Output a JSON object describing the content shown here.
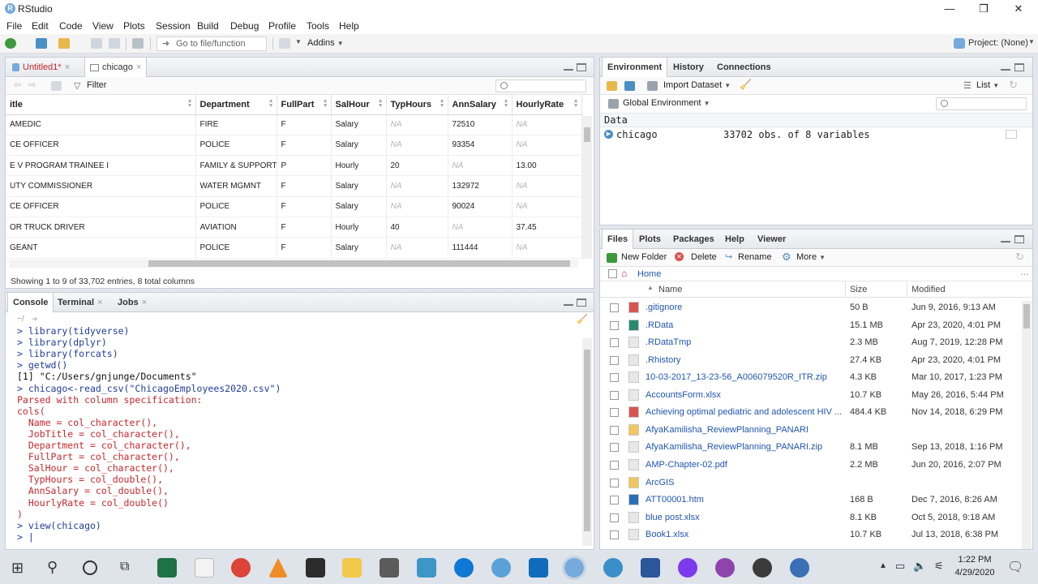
{
  "window": {
    "title": "RStudio",
    "controls": [
      "—",
      "❐",
      "✕"
    ]
  },
  "menu": [
    "File",
    "Edit",
    "Code",
    "View",
    "Plots",
    "Session",
    "Build",
    "Debug",
    "Profile",
    "Tools",
    "Help"
  ],
  "toolbar": {
    "goto_placeholder": "Go to file/function",
    "addins_label": "Addins",
    "project_label": "Project: (None)"
  },
  "source_pane": {
    "tabs": [
      {
        "label": "Untitled1*"
      },
      {
        "label": "chicago"
      }
    ],
    "filter_label": "Filter",
    "columns": [
      "itle",
      "Department",
      "FullPart",
      "SalHour",
      "TypHours",
      "AnnSalary",
      "HourlyRate"
    ],
    "rows": [
      [
        "AMEDIC",
        "FIRE",
        "F",
        "Salary",
        "NA",
        "72510",
        "NA"
      ],
      [
        "CE OFFICER",
        "POLICE",
        "F",
        "Salary",
        "NA",
        "93354",
        "NA"
      ],
      [
        "E V PROGRAM TRAINEE I",
        "FAMILY & SUPPORT",
        "P",
        "Hourly",
        "20",
        "NA",
        "13.00"
      ],
      [
        "UTY COMMISSIONER",
        "WATER MGMNT",
        "F",
        "Salary",
        "NA",
        "132972",
        "NA"
      ],
      [
        "CE OFFICER",
        "POLICE",
        "F",
        "Salary",
        "NA",
        "90024",
        "NA"
      ],
      [
        "OR TRUCK DRIVER",
        "AVIATION",
        "F",
        "Hourly",
        "40",
        "NA",
        "37.45"
      ],
      [
        "GEANT",
        "POLICE",
        "F",
        "Salary",
        "NA",
        "111444",
        "NA"
      ]
    ],
    "footer": "Showing 1 to 9 of 33,702 entries, 8 total columns"
  },
  "console_pane": {
    "tabs": [
      {
        "label": "Console"
      },
      {
        "label": "Terminal"
      },
      {
        "label": "Jobs"
      }
    ],
    "path": "~/",
    "lines": [
      {
        "text": "> library(tidyverse)",
        "style": "blue"
      },
      {
        "text": "> library(dplyr)",
        "style": "blue"
      },
      {
        "text": "> library(forcats)",
        "style": "blue"
      },
      {
        "text": "> getwd()",
        "style": "blue"
      },
      {
        "text": "[1] \"C:/Users/gnjunge/Documents\"",
        "style": "black"
      },
      {
        "text": "> chicago<-read_csv(\"ChicagoEmployees2020.csv\")",
        "style": "blue"
      },
      {
        "text": "Parsed with column specification:",
        "style": "red"
      },
      {
        "text": "cols(",
        "style": "red"
      },
      {
        "text": "  Name = col_character(),",
        "style": "red"
      },
      {
        "text": "  JobTitle = col_character(),",
        "style": "red"
      },
      {
        "text": "  Department = col_character(),",
        "style": "red"
      },
      {
        "text": "  FullPart = col_character(),",
        "style": "red"
      },
      {
        "text": "  SalHour = col_character(),",
        "style": "red"
      },
      {
        "text": "  TypHours = col_double(),",
        "style": "red"
      },
      {
        "text": "  AnnSalary = col_double(),",
        "style": "red"
      },
      {
        "text": "  HourlyRate = col_double()",
        "style": "red"
      },
      {
        "text": ")",
        "style": "red"
      },
      {
        "text": "> view(chicago)",
        "style": "blue"
      },
      {
        "text": "> |",
        "style": "blue"
      }
    ]
  },
  "env_pane": {
    "tabs": [
      {
        "label": "Environment"
      },
      {
        "label": "History"
      },
      {
        "label": "Connections"
      }
    ],
    "import_label": "Import Dataset",
    "list_label": "List",
    "global_env_label": "Global Environment",
    "section_label": "Data",
    "object_name": "chicago",
    "object_desc": "33702 obs. of 8 variables"
  },
  "files_pane": {
    "tabs": [
      {
        "label": "Files"
      },
      {
        "label": "Plots"
      },
      {
        "label": "Packages"
      },
      {
        "label": "Help"
      },
      {
        "label": "Viewer"
      }
    ],
    "new_folder_label": "New Folder",
    "delete_label": "Delete",
    "rename_label": "Rename",
    "more_label": "More",
    "home_label": "Home",
    "col_name": "Name",
    "col_size": "Size",
    "col_modified": "Modified",
    "files": [
      {
        "name": ".gitignore",
        "size": "50 B",
        "modified": "Jun 9, 2016, 9:13 AM",
        "icon_color": "#d9534f"
      },
      {
        "name": ".RData",
        "size": "15.1 MB",
        "modified": "Apr 23, 2020, 4:01 PM",
        "icon_color": "#2b8a6e"
      },
      {
        "name": ".RDataTmp",
        "size": "2.3 MB",
        "modified": "Aug 7, 2019, 12:28 PM",
        "icon_color": "#e8e8e8"
      },
      {
        "name": ".Rhistory",
        "size": "27.4 KB",
        "modified": "Apr 23, 2020, 4:01 PM",
        "icon_color": "#e8e8e8"
      },
      {
        "name": "10-03-2017_13-23-56_A006079520R_ITR.zip",
        "size": "4.3 KB",
        "modified": "Mar 10, 2017, 1:23 PM",
        "icon_color": "#e8e8e8"
      },
      {
        "name": "AccountsForm.xlsx",
        "size": "10.7 KB",
        "modified": "May 26, 2016, 5:44 PM",
        "icon_color": "#e8e8e8"
      },
      {
        "name": "Achieving optimal pediatric and adolescent HIV ...",
        "size": "484.4 KB",
        "modified": "Nov 14, 2018, 6:29 PM",
        "icon_color": "#d9534f"
      },
      {
        "name": "AfyaKamilisha_ReviewPlanning_PANARI",
        "size": "",
        "modified": "",
        "icon_color": "#f0c75e"
      },
      {
        "name": "AfyaKamilisha_ReviewPlanning_PANARI.zip",
        "size": "8.1 MB",
        "modified": "Sep 13, 2018, 1:16 PM",
        "icon_color": "#e8e8e8"
      },
      {
        "name": "AMP-Chapter-02.pdf",
        "size": "2.2 MB",
        "modified": "Jun 20, 2016, 2:07 PM",
        "icon_color": "#e8e8e8"
      },
      {
        "name": "ArcGIS",
        "size": "",
        "modified": "",
        "icon_color": "#f0c75e"
      },
      {
        "name": "ATT00001.htm",
        "size": "168 B",
        "modified": "Dec 7, 2016, 8:26 AM",
        "icon_color": "#2a6ebb"
      },
      {
        "name": "blue post.xlsx",
        "size": "8.1 KB",
        "modified": "Oct 5, 2018, 9:18 AM",
        "icon_color": "#e8e8e8"
      },
      {
        "name": "Book1.xlsx",
        "size": "10.7 KB",
        "modified": "Jul 13, 2018, 6:38 PM",
        "icon_color": "#e8e8e8"
      }
    ]
  },
  "taskbar": {
    "time": "1:22 PM",
    "date": "4/29/2020"
  }
}
